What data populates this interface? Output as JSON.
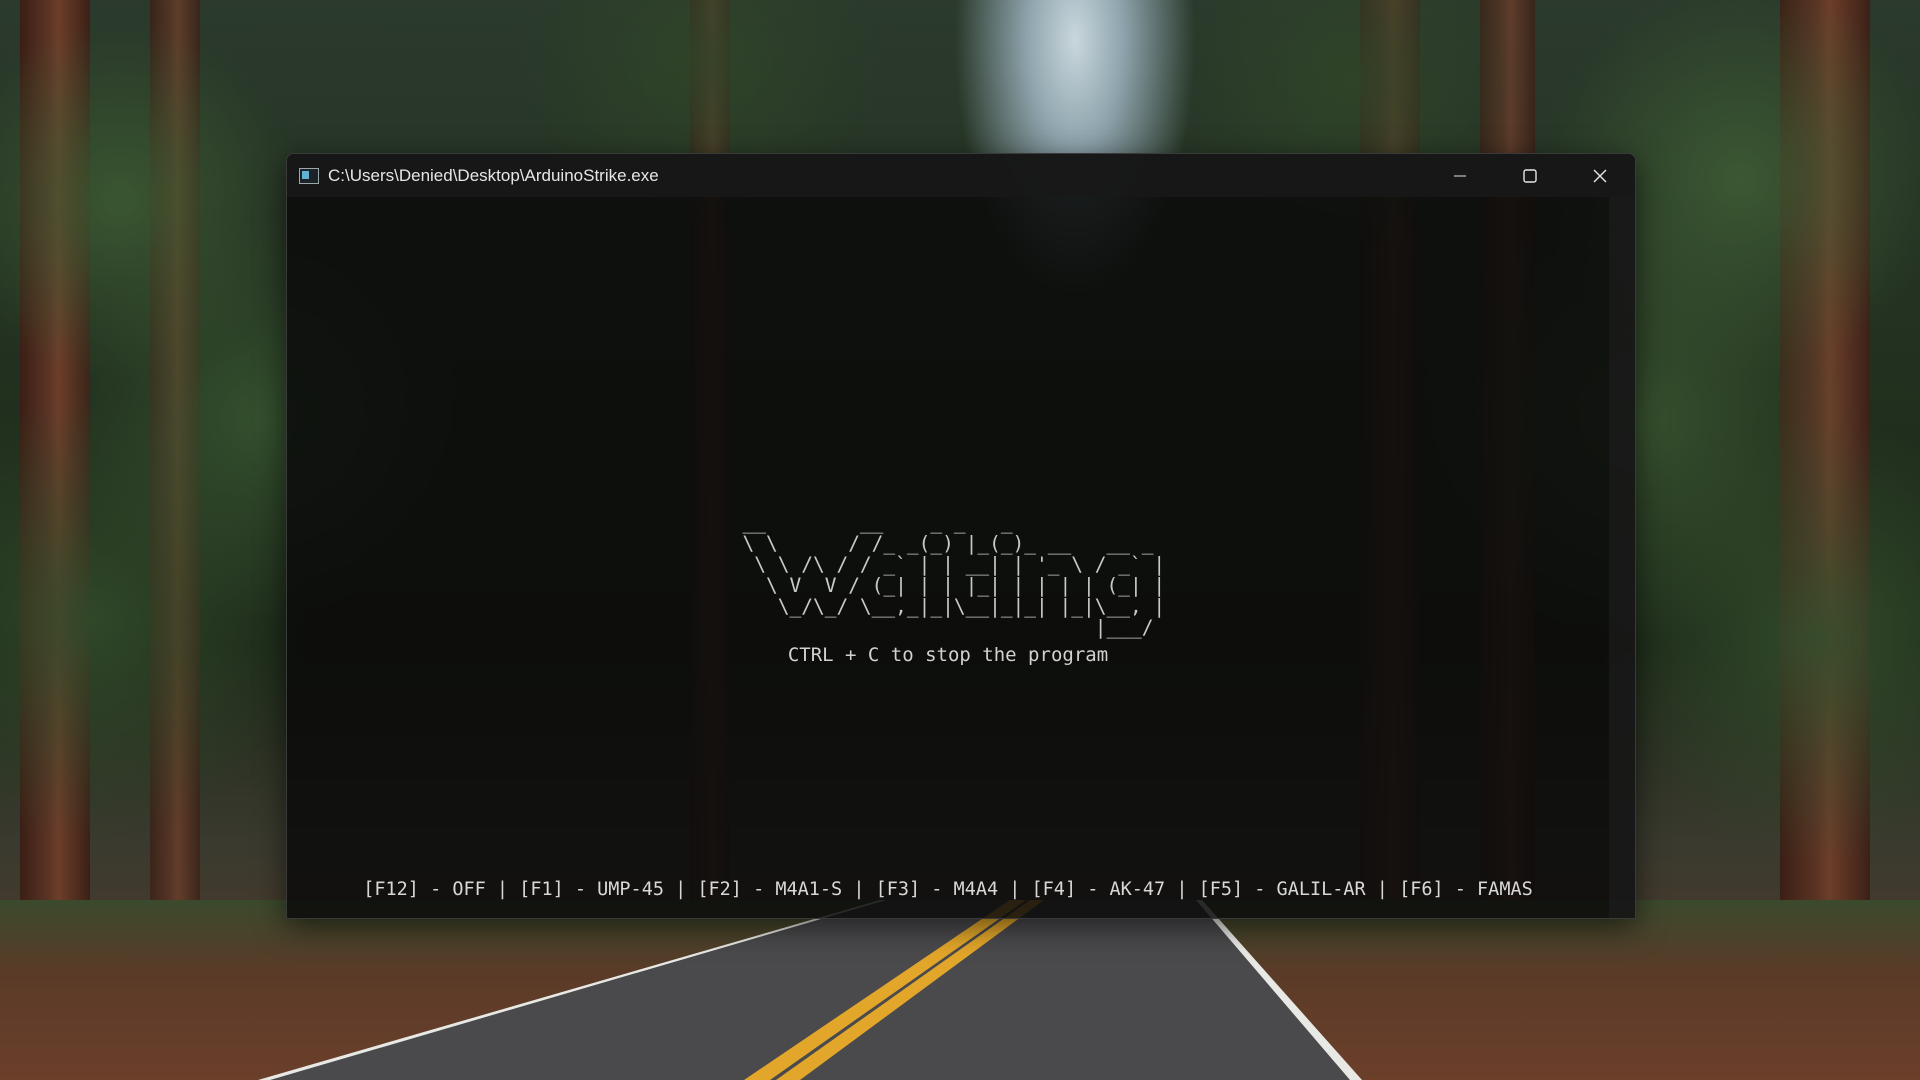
{
  "window": {
    "title": "C:\\Users\\Denied\\Desktop\\ArduinoStrike.exe",
    "controls": {
      "minimize": "minimize",
      "maximize": "maximize",
      "close": "close"
    }
  },
  "console": {
    "banner": " __        __    _ _   _             \n \\ \\      / /_ _(_) |_(_)_ __   __ _ \n  \\ \\ /\\ / / _` | | __| | '_ \\ / _` |\n   \\ V  V / (_| | | |_| | | | | (_| |\n    \\_/\\_/ \\__,_|_|\\__|_|_| |_|\\__, |\n                               |___/ ",
    "hint": "CTRL + C to stop the program",
    "hotkeys": "[F12] - OFF | [F1] - UMP-45 | [F2] - M4A1-S | [F3] - M4A4 | [F4] - AK-47 | [F5] - GALIL-AR | [F6] - FAMAS"
  },
  "icons": {
    "app": "console-app-icon",
    "minimize": "minimize-icon",
    "maximize": "maximize-icon",
    "close": "close-icon"
  }
}
